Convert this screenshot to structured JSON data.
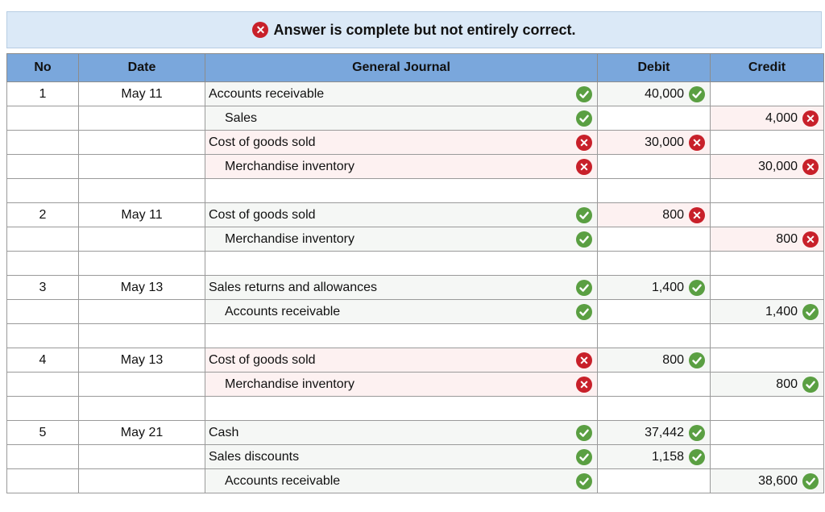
{
  "banner": {
    "status": "error",
    "message": "Answer is complete but not entirely correct."
  },
  "columns": {
    "no": "No",
    "date": "Date",
    "journal": "General Journal",
    "debit": "Debit",
    "credit": "Credit"
  },
  "colors": {
    "header": "#7aa7dc",
    "correct": "#5a9f42",
    "incorrect": "#c8202a",
    "banner": "#dbe9f7"
  },
  "rows": [
    {
      "no": "1",
      "date": "May 11",
      "account": "Accounts receivable",
      "indent": false,
      "account_mark": "check",
      "debit": "40,000",
      "debit_mark": "check",
      "credit": "",
      "credit_mark": ""
    },
    {
      "no": "",
      "date": "",
      "account": "Sales",
      "indent": true,
      "account_mark": "check",
      "debit": "",
      "debit_mark": "",
      "credit": "4,000",
      "credit_mark": "x"
    },
    {
      "no": "",
      "date": "",
      "account": "Cost of goods sold",
      "indent": false,
      "account_mark": "x",
      "debit": "30,000",
      "debit_mark": "x",
      "credit": "",
      "credit_mark": ""
    },
    {
      "no": "",
      "date": "",
      "account": "Merchandise inventory",
      "indent": true,
      "account_mark": "x",
      "debit": "",
      "debit_mark": "",
      "credit": "30,000",
      "credit_mark": "x"
    },
    {
      "no": "",
      "date": "",
      "account": "",
      "indent": false,
      "account_mark": "",
      "debit": "",
      "debit_mark": "",
      "credit": "",
      "credit_mark": ""
    },
    {
      "no": "2",
      "date": "May 11",
      "account": "Cost of goods sold",
      "indent": false,
      "account_mark": "check",
      "debit": "800",
      "debit_mark": "x",
      "credit": "",
      "credit_mark": ""
    },
    {
      "no": "",
      "date": "",
      "account": "Merchandise inventory",
      "indent": true,
      "account_mark": "check",
      "debit": "",
      "debit_mark": "",
      "credit": "800",
      "credit_mark": "x"
    },
    {
      "no": "",
      "date": "",
      "account": "",
      "indent": false,
      "account_mark": "",
      "debit": "",
      "debit_mark": "",
      "credit": "",
      "credit_mark": ""
    },
    {
      "no": "3",
      "date": "May 13",
      "account": "Sales returns and allowances",
      "indent": false,
      "account_mark": "check",
      "debit": "1,400",
      "debit_mark": "check",
      "credit": "",
      "credit_mark": ""
    },
    {
      "no": "",
      "date": "",
      "account": "Accounts receivable",
      "indent": true,
      "account_mark": "check",
      "debit": "",
      "debit_mark": "",
      "credit": "1,400",
      "credit_mark": "check"
    },
    {
      "no": "",
      "date": "",
      "account": "",
      "indent": false,
      "account_mark": "",
      "debit": "",
      "debit_mark": "",
      "credit": "",
      "credit_mark": ""
    },
    {
      "no": "4",
      "date": "May 13",
      "account": "Cost of goods sold",
      "indent": false,
      "account_mark": "x",
      "debit": "800",
      "debit_mark": "check",
      "credit": "",
      "credit_mark": ""
    },
    {
      "no": "",
      "date": "",
      "account": "Merchandise inventory",
      "indent": true,
      "account_mark": "x",
      "debit": "",
      "debit_mark": "",
      "credit": "800",
      "credit_mark": "check"
    },
    {
      "no": "",
      "date": "",
      "account": "",
      "indent": false,
      "account_mark": "",
      "debit": "",
      "debit_mark": "",
      "credit": "",
      "credit_mark": ""
    },
    {
      "no": "5",
      "date": "May 21",
      "account": "Cash",
      "indent": false,
      "account_mark": "check",
      "debit": "37,442",
      "debit_mark": "check",
      "credit": "",
      "credit_mark": ""
    },
    {
      "no": "",
      "date": "",
      "account": "Sales discounts",
      "indent": false,
      "account_mark": "check",
      "debit": "1,158",
      "debit_mark": "check",
      "credit": "",
      "credit_mark": ""
    },
    {
      "no": "",
      "date": "",
      "account": "Accounts receivable",
      "indent": true,
      "account_mark": "check",
      "debit": "",
      "debit_mark": "",
      "credit": "38,600",
      "credit_mark": "check"
    }
  ]
}
